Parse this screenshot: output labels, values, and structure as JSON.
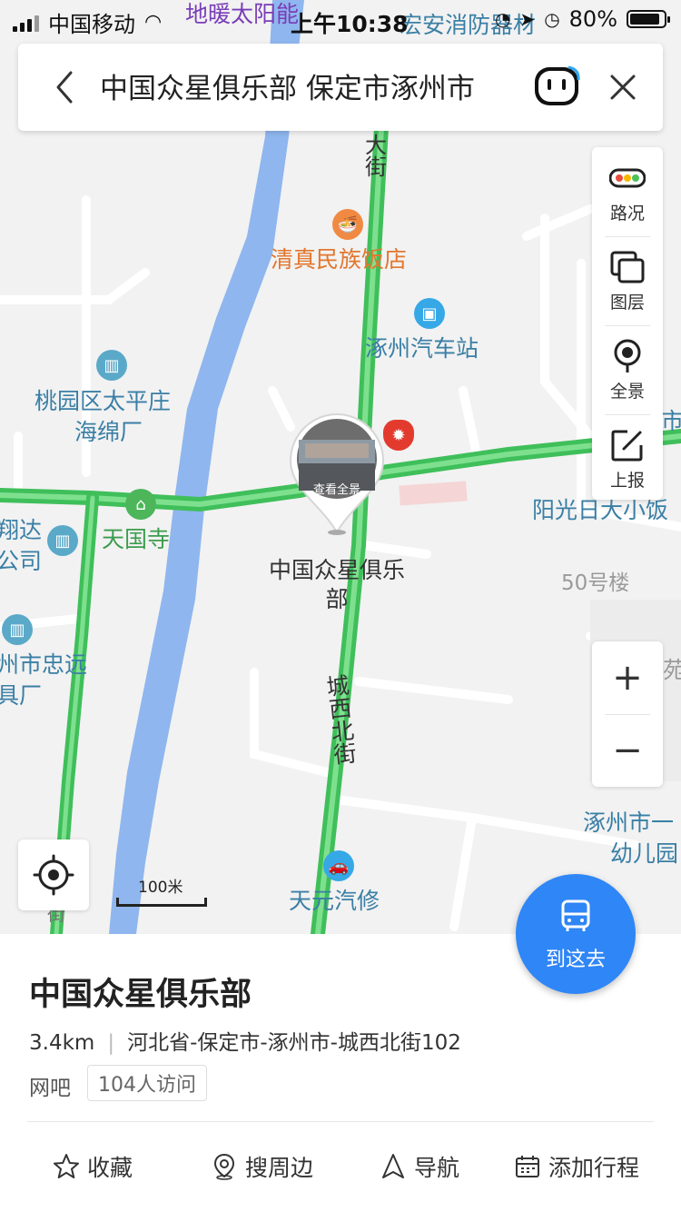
{
  "status_bar": {
    "carrier": "中国移动",
    "time": "上午10:38",
    "battery": "80%"
  },
  "search": {
    "query": "中国众星俱乐部 保定市涿州市"
  },
  "map": {
    "labels": {
      "top_poi_purple": "地暖太阳能",
      "top_poi_blue": "宏安消防器材",
      "road_top": "街",
      "road_top2": "大",
      "restaurant": "清真民族饭店",
      "bus_station": "涿州汽车站",
      "sponge_factory_1": "桃园区太平庄",
      "sponge_factory_2": "海绵厂",
      "temple": "天国寺",
      "xiangda_1": "翔达",
      "xiangda_2": "公司",
      "zhongyuan_1": "州市忠远",
      "zhongyuan_2": "具厂",
      "right_edge_city": "市",
      "yangguang": "阳光日大小饭",
      "bldg50": "50号楼",
      "yuan_right": "苑",
      "kindergarten_1": "涿州市一",
      "kindergarten_2": "幼儿园",
      "road_name": "城西北街",
      "auto_repair": "天元汽修",
      "bottom_left_road": "街",
      "marker_name": "中国众星俱乐部",
      "panorama_caption": "查看全景"
    },
    "scale": "100米"
  },
  "toolbar": {
    "traffic": "路况",
    "layers": "图层",
    "panorama": "全景",
    "report": "上报"
  },
  "zoom": {
    "in": "+",
    "out": "−"
  },
  "go_button": {
    "label": "到这去"
  },
  "place": {
    "name": "中国众星俱乐部",
    "distance": "3.4km",
    "address": "河北省-保定市-涿州市-城西北街102",
    "category": "网吧",
    "visits": "104人访问"
  },
  "actions": {
    "favorite": "收藏",
    "nearby": "搜周边",
    "navigate": "导航",
    "add_trip": "添加行程"
  },
  "colors": {
    "accent": "#2f86f6",
    "road_green": "#4cd964",
    "river": "#8fb6ee"
  }
}
